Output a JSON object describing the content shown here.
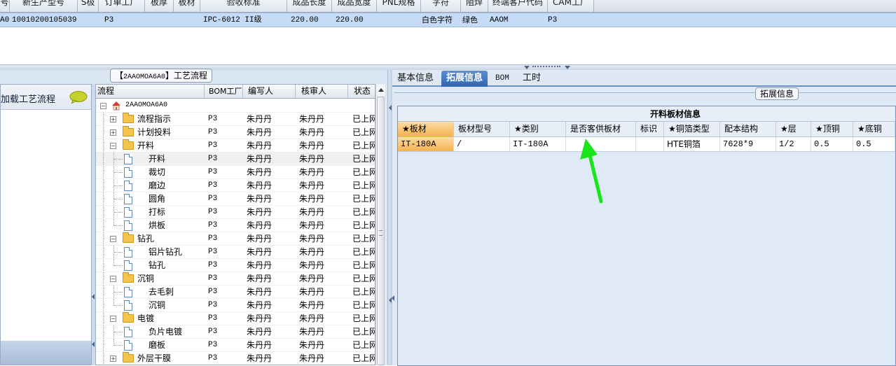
{
  "top_grid": {
    "headers": [
      "号",
      "新生产型号",
      "S极",
      "订单工厂",
      "板厚",
      "板材",
      "验收标准",
      "成品长度",
      "成品宽度",
      "PNL规格",
      "字符",
      "阻焊",
      "终端客户代码",
      "CAM工厂"
    ],
    "row": [
      "A0",
      "10010200105039",
      "",
      "P3",
      "",
      "",
      "IPC-6012 II级",
      "220.00",
      "220.00",
      "",
      "白色字符",
      "绿色",
      "AAOM",
      "P3"
    ]
  },
  "left_panel": {
    "title_prefix": "【",
    "title_code": "2AAOMOA6A0",
    "title_suffix": "】工艺流程",
    "loader_label": "加载工艺流程",
    "tree_headers": [
      "流程",
      "BOM工厂",
      "编写人",
      "核审人",
      "状态"
    ],
    "tree_rows": [
      {
        "name": "2AAOMOA6A0",
        "type": "root",
        "bom": "",
        "writer": "",
        "checker": "",
        "status": ""
      },
      {
        "name": "流程指示",
        "type": "folder-collapsed",
        "bom": "P3",
        "writer": "朱丹丹",
        "checker": "朱丹丹",
        "status": "已上网"
      },
      {
        "name": "计划投料",
        "type": "folder-collapsed",
        "bom": "P3",
        "writer": "朱丹丹",
        "checker": "朱丹丹",
        "status": "已上网"
      },
      {
        "name": "开料",
        "type": "folder-open",
        "bom": "P3",
        "writer": "朱丹丹",
        "checker": "朱丹丹",
        "status": "已上网"
      },
      {
        "name": "开料",
        "type": "doc",
        "bom": "P3",
        "writer": "朱丹丹",
        "checker": "朱丹丹",
        "status": "已上网",
        "selected": true
      },
      {
        "name": "裁切",
        "type": "doc",
        "bom": "P3",
        "writer": "朱丹丹",
        "checker": "朱丹丹",
        "status": "已上网"
      },
      {
        "name": "磨边",
        "type": "doc",
        "bom": "P3",
        "writer": "朱丹丹",
        "checker": "朱丹丹",
        "status": "已上网"
      },
      {
        "name": "圆角",
        "type": "doc",
        "bom": "P3",
        "writer": "朱丹丹",
        "checker": "朱丹丹",
        "status": "已上网"
      },
      {
        "name": "打标",
        "type": "doc",
        "bom": "P3",
        "writer": "朱丹丹",
        "checker": "朱丹丹",
        "status": "已上网"
      },
      {
        "name": "烘板",
        "type": "doc-last",
        "bom": "P3",
        "writer": "朱丹丹",
        "checker": "朱丹丹",
        "status": "已上网"
      },
      {
        "name": "钻孔",
        "type": "folder-open",
        "bom": "P3",
        "writer": "朱丹丹",
        "checker": "朱丹丹",
        "status": "已上网"
      },
      {
        "name": "铝片钻孔",
        "type": "doc",
        "bom": "P3",
        "writer": "朱丹丹",
        "checker": "朱丹丹",
        "status": "已上网"
      },
      {
        "name": "钻孔",
        "type": "doc-last",
        "bom": "P3",
        "writer": "朱丹丹",
        "checker": "朱丹丹",
        "status": "已上网"
      },
      {
        "name": "沉铜",
        "type": "folder-open",
        "bom": "P3",
        "writer": "朱丹丹",
        "checker": "朱丹丹",
        "status": "已上网"
      },
      {
        "name": "去毛刺",
        "type": "doc",
        "bom": "P3",
        "writer": "朱丹丹",
        "checker": "朱丹丹",
        "status": "已上网"
      },
      {
        "name": "沉铜",
        "type": "doc-last",
        "bom": "P3",
        "writer": "朱丹丹",
        "checker": "朱丹丹",
        "status": "已上网"
      },
      {
        "name": "电镀",
        "type": "folder-open",
        "bom": "P3",
        "writer": "朱丹丹",
        "checker": "朱丹丹",
        "status": "已上网"
      },
      {
        "name": "负片电镀",
        "type": "doc",
        "bom": "P3",
        "writer": "朱丹丹",
        "checker": "朱丹丹",
        "status": "已上网"
      },
      {
        "name": "磨板",
        "type": "doc-last",
        "bom": "P3",
        "writer": "朱丹丹",
        "checker": "朱丹丹",
        "status": "已上网"
      },
      {
        "name": "外层干膜",
        "type": "folder-collapsed",
        "bom": "P3",
        "writer": "朱丹丹",
        "checker": "朱丹丹",
        "status": "已上网"
      }
    ]
  },
  "right_panel": {
    "tabs": [
      "基本信息",
      "拓展信息",
      "BOM",
      "工时"
    ],
    "active_tab": "拓展信息",
    "group_title": "拓展信息",
    "table_title": "开料板材信息",
    "headers": [
      "★板材",
      "板材型号",
      "★类别",
      "是否客供板材",
      "标识",
      "★铜箔类型",
      "配本结构",
      "★层",
      "★顶铜",
      "★底铜"
    ],
    "row": [
      "IT-180A",
      "/",
      "IT-180A",
      "",
      "",
      "HTE铜箔",
      "7628*9",
      "1/2",
      "0.5",
      "0.5"
    ]
  },
  "colors": {
    "selection_blue": "#c6dcf6",
    "active_tab": "#2d63b0",
    "highlight_orange": "#f6b24e",
    "arrow_green": "#19e619"
  }
}
